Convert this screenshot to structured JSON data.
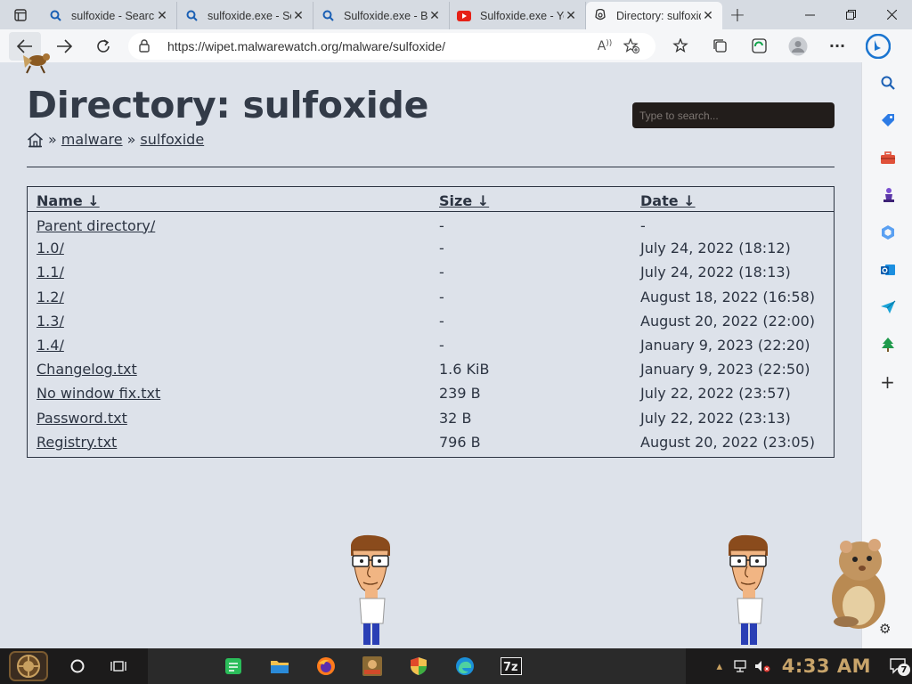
{
  "browser": {
    "tabs": [
      {
        "title": "sulfoxide - Search",
        "icon": "search-icon",
        "active": false
      },
      {
        "title": "sulfoxide.exe - Search",
        "icon": "search-icon",
        "active": false
      },
      {
        "title": "Sulfoxide.exe - Bing",
        "icon": "search-icon",
        "active": false
      },
      {
        "title": "Sulfoxide.exe - YouTube",
        "icon": "youtube-icon",
        "active": false
      },
      {
        "title": "Directory: sulfoxide",
        "icon": "page-icon",
        "active": true
      }
    ],
    "url": "https://wipet.malwarewatch.org/malware/sulfoxide/"
  },
  "page": {
    "title": "Directory: sulfoxide",
    "breadcrumb": {
      "home_icon": "home-icon",
      "separator": "»",
      "items": [
        "malware",
        "sulfoxide"
      ]
    },
    "search_placeholder": "Type to search...",
    "columns": {
      "name": "Name ↓",
      "size": "Size ↓",
      "date": "Date ↓"
    },
    "rows": [
      {
        "name": "Parent directory/",
        "size": "-",
        "date": "-"
      },
      {
        "name": "1.0/",
        "size": "-",
        "date": "July 24, 2022 (18:12)"
      },
      {
        "name": "1.1/",
        "size": "-",
        "date": "July 24, 2022 (18:13)"
      },
      {
        "name": "1.2/",
        "size": "-",
        "date": "August 18, 2022 (16:58)"
      },
      {
        "name": "1.3/",
        "size": "-",
        "date": "August 20, 2022 (22:00)"
      },
      {
        "name": "1.4/",
        "size": "-",
        "date": "January 9, 2023 (22:20)"
      },
      {
        "name": "Changelog.txt",
        "size": "1.6 KiB",
        "date": "January 9, 2023 (22:50)"
      },
      {
        "name": "No window fix.txt",
        "size": "239 B",
        "date": "July 22, 2022 (23:57)"
      },
      {
        "name": "Password.txt",
        "size": "32 B",
        "date": "July 22, 2022 (23:13)"
      },
      {
        "name": "Registry.txt",
        "size": "796 B",
        "date": "August 20, 2022 (23:05)"
      }
    ]
  },
  "taskbar": {
    "clock": "4:33 AM",
    "notification_count": "7"
  },
  "colors": {
    "page_bg": "#dde2ea",
    "text": "#2c3442",
    "search_bg": "#221d1b",
    "clock": "#c8a46a"
  }
}
